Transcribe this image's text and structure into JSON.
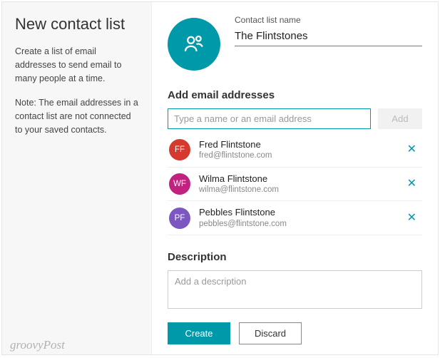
{
  "colors": {
    "accent": "#0099aa",
    "avatar_bgs": [
      "#d63a2f",
      "#c1217f",
      "#7d57c1"
    ]
  },
  "left": {
    "title": "New contact list",
    "description": "Create a list of email addresses to send email to many people at a time.",
    "note": "Note: The email addresses in a contact list are not connected to your saved contacts."
  },
  "header": {
    "name_label": "Contact list name",
    "name_value": "The Flintstones",
    "avatar_icon": "people-icon"
  },
  "add_emails": {
    "title": "Add email addresses",
    "input_placeholder": "Type a name or an email address",
    "add_button": "Add"
  },
  "contacts": [
    {
      "initials": "FF",
      "name": "Fred Flintstone",
      "email": "fred@flintstone.com"
    },
    {
      "initials": "WF",
      "name": "Wilma Flintstone",
      "email": "wilma@flintstone.com"
    },
    {
      "initials": "PF",
      "name": "Pebbles Flintstone",
      "email": "pebbles@flintstone.com"
    }
  ],
  "description": {
    "title": "Description",
    "placeholder": "Add a description"
  },
  "buttons": {
    "create": "Create",
    "discard": "Discard"
  },
  "watermark": "groovyPost"
}
